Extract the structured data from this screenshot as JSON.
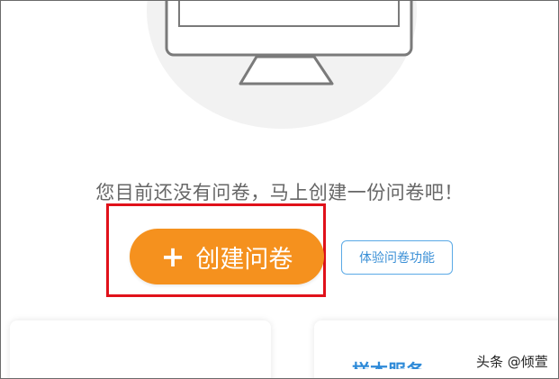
{
  "empty_state": {
    "message": "您目前还没有问卷，马上创建一份问卷吧！",
    "illustration_icon": "monitor-icon"
  },
  "actions": {
    "create_label": "创建问卷",
    "create_icon": "plus-icon",
    "trial_label": "体验问卷功能"
  },
  "cards": {
    "right_title": "样本服务"
  },
  "watermark": {
    "text": "头条 @倾萱"
  },
  "colors": {
    "primary_orange": "#f5911e",
    "link_blue": "#3a8fd6",
    "highlight_red": "#e0111a"
  }
}
